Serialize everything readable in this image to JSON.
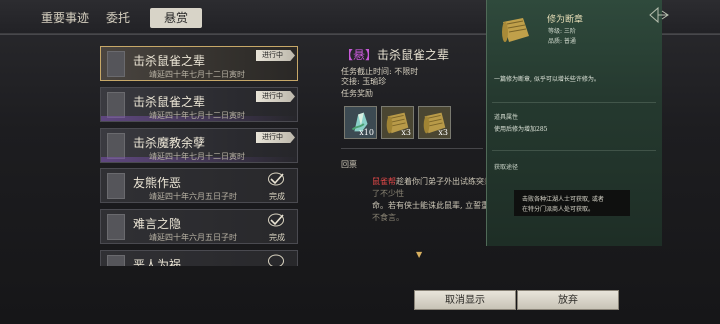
{
  "tabs": [
    {
      "label": "重要事迹"
    },
    {
      "label": "委托"
    },
    {
      "label": "悬赏"
    }
  ],
  "quests": [
    {
      "title": "击杀鼠雀之辈",
      "date": "靖延四十年七月十二日寅时",
      "status": "进行中",
      "active": true
    },
    {
      "title": "击杀鼠雀之辈",
      "date": "靖延四十年七月十二日寅时",
      "status": "进行中"
    },
    {
      "title": "击杀魔教余孽",
      "date": "靖延四十年七月十二日寅时",
      "status": "进行中"
    },
    {
      "title": "友熊作恶",
      "date": "靖延四十年六月五日子时",
      "status": "完成"
    },
    {
      "title": "难言之隐",
      "date": "靖延四十年六月五日子时",
      "status": "完成"
    },
    {
      "title": "恶人为祸",
      "date": "",
      "status": ""
    }
  ],
  "detail": {
    "tag": "【悬】",
    "title": "击杀鼠雀之辈",
    "deadline": "任务截止时间: 不限时",
    "contact": "交接: 玉瑜珍",
    "reward_label": "任务奖励",
    "rewards": [
      {
        "icon": "herb-icon",
        "qty": "x10"
      },
      {
        "icon": "scroll-icon",
        "qty": "x3"
      },
      {
        "icon": "scroll-icon",
        "qty": "x3"
      }
    ],
    "section_label": "回禀",
    "story_name": "鼠雀帮",
    "story_line1": "趁着你门弟子外出试练突",
    "story_line1_tail": "然袭击, 害了不少性",
    "story_line2": "命。若有侠士能诛此鼠辈, 立誓重金",
    "story_line2_tail": "酬, 决不食言。"
  },
  "item_panel": {
    "name": "修为断章",
    "grade": "等级: 三阶",
    "quality": "品质: 普通",
    "desc": "一篇修为断章, 似乎可以增长些许修为。",
    "effect_label": "道具属性",
    "effect": "使用后修为增加285",
    "source_label": "获取途径",
    "source_line1": "击败各种江湖人士可获取, 或者",
    "source_line2": "在特分门派商人处可获取。"
  },
  "buttons": {
    "cancel": "取消显示",
    "abandon": "放弃"
  },
  "colors": {
    "accent_gold": "#c7a868",
    "tag_purple": "#c85ad8",
    "name_red": "#e04848"
  }
}
